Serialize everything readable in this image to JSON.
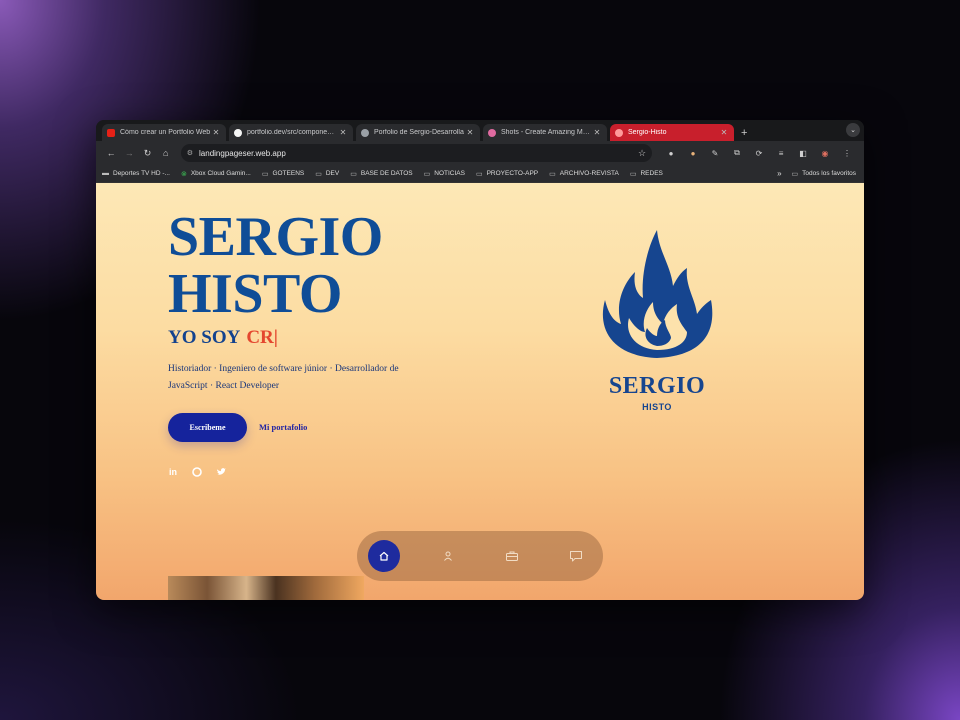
{
  "browser": {
    "tabs": [
      {
        "title": "Cómo crear un Portfolio Web",
        "favicon": "youtube-icon",
        "color": "#ff0000"
      },
      {
        "title": "portfolio.dev/src/components/",
        "favicon": "github-icon",
        "color": "#ffffff"
      },
      {
        "title": "Porfolio de Sergio-Desarrolla",
        "favicon": "rocket-icon",
        "color": "#cccccc"
      },
      {
        "title": "Shots - Create Amazing Mock",
        "favicon": "shots-icon",
        "color": "#e06aa0"
      },
      {
        "title": "Sergio-Histo",
        "favicon": "flame-icon",
        "color": "#ff6a6a"
      }
    ],
    "new_tab": "+",
    "url": "landingpageser.web.app",
    "bookmarks": [
      {
        "label": "Deportes TV HD -...",
        "icon": "tv-icon"
      },
      {
        "label": "Xbox Cloud Gamin...",
        "icon": "xbox-icon"
      },
      {
        "label": "GOTEENS",
        "icon": "folder-icon"
      },
      {
        "label": "DEV",
        "icon": "folder-icon"
      },
      {
        "label": "BASE DE DATOS",
        "icon": "folder-icon"
      },
      {
        "label": "NOTICIAS",
        "icon": "folder-icon"
      },
      {
        "label": "PROYECTO-APP",
        "icon": "folder-icon"
      },
      {
        "label": "ARCHIVO-REVISTA",
        "icon": "folder-icon"
      },
      {
        "label": "REDES",
        "icon": "folder-icon"
      }
    ],
    "bookmarks_more": "»",
    "all_bookmarks": "Todos los favoritos"
  },
  "hero": {
    "name_line1": "SERGIO",
    "name_line2": "HISTO",
    "yo_soy": "YO SOY",
    "typed": "CR|",
    "description": "Historiador · Ingeniero de software júnior · Desarrollador de JavaScript · React Developer",
    "cta_primary": "Escribeme",
    "cta_secondary": "Mi portafolio",
    "socials": [
      "linkedin-icon",
      "github-icon",
      "twitter-icon"
    ]
  },
  "logo": {
    "title": "SERGIO",
    "subtitle": "HISTO"
  },
  "dock": {
    "items": [
      "home-icon",
      "user-icon",
      "briefcase-icon",
      "message-icon"
    ],
    "active": "home-icon"
  },
  "colors": {
    "accent_blue": "#0f4d97",
    "button_blue": "#15239c",
    "typed_red": "#e4472f",
    "active_tab": "#c81f2c"
  }
}
